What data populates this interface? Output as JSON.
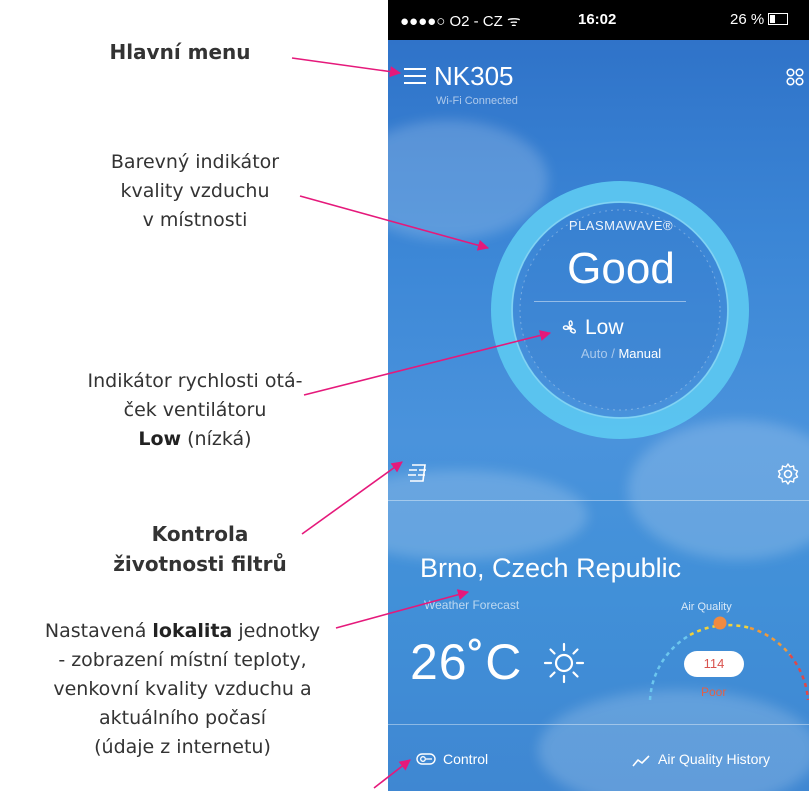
{
  "annotations": {
    "menu": "Hlavní menu",
    "indicator": [
      "Barevný indikátor",
      "kvality vzduchu",
      "v místnosti"
    ],
    "fan": {
      "line1": "Indikátor rychlosti otá-",
      "line2": "ček ventilátoru",
      "line3_bold": "Low",
      "line3_rest": " (nízká)"
    },
    "filter": [
      "Kontrola",
      "životnosti filtrů"
    ],
    "location": {
      "line1_pre": "Nastavená ",
      "line1_bold": "lokalita",
      "line1_post": " jednotky",
      "lines": [
        "- zobrazení místní teploty,",
        "venkovní kvality vzduchu a",
        "aktuálního počasí",
        "(údaje z internetu)"
      ]
    }
  },
  "status_bar": {
    "carrier": "●●●●○ O2 - CZ ᯤ",
    "time": "16:02",
    "battery": "26 %"
  },
  "header": {
    "device_name": "NK305",
    "connection": "Wi-Fi Connected"
  },
  "air_quality": {
    "brand": "PLASMAWAVE®",
    "value": "Good",
    "ring_color": "#5cc6f0"
  },
  "fan": {
    "speed": "Low",
    "mode_auto": "Auto",
    "mode_separator": " / ",
    "mode_manual": "Manual"
  },
  "weather": {
    "location": "Brno, Czech Republic",
    "forecast_label": "Weather Forecast",
    "temperature": "26˚C",
    "condition_icon": "sun-icon"
  },
  "outdoor_air": {
    "label": "Air Quality",
    "value": "114",
    "status": "Poor",
    "status_color": "#e06048"
  },
  "bottom_nav": {
    "control": "Control",
    "history": "Air Quality History"
  },
  "colors": {
    "arrow": "#e5197b",
    "background_top": "#2d6fc6",
    "background_bottom": "#3f87d2"
  }
}
